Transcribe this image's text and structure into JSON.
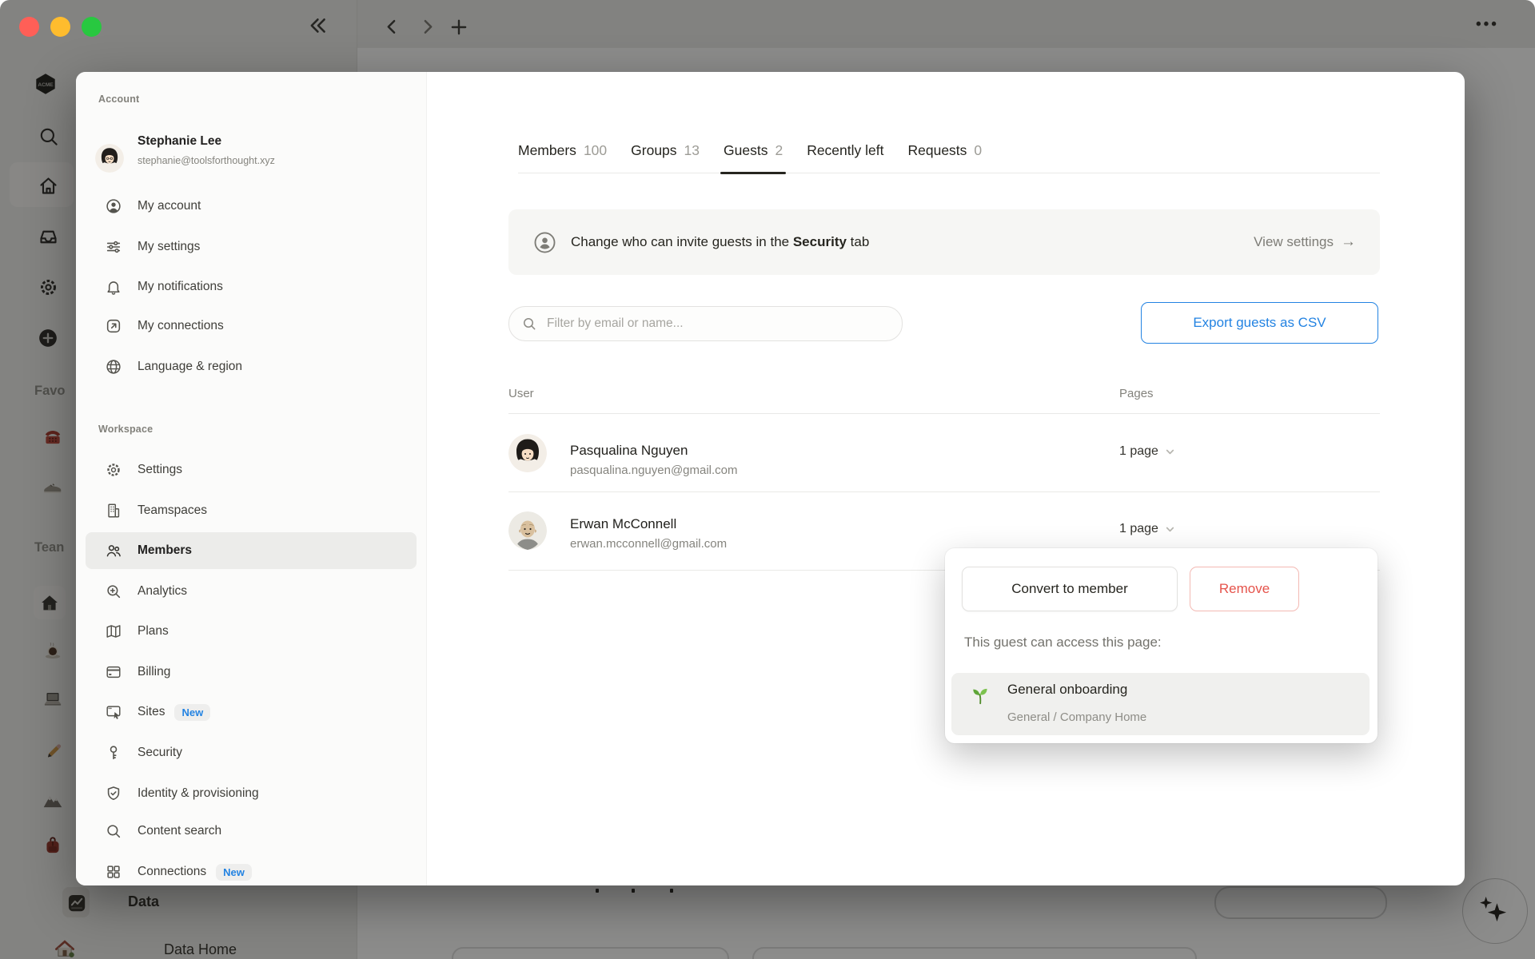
{
  "window": {
    "controls": {
      "close": "close",
      "minimize": "minimize",
      "zoom": "zoom"
    },
    "ellipsis": "•••"
  },
  "rail": {
    "workspace_logo": "ACME",
    "favorites_label": "Favo",
    "teamspaces_label": "Tean",
    "data_section": {
      "label": "Data",
      "icon": "chart-icon"
    },
    "data_home": {
      "label": "Data Home",
      "icon": "house-icon"
    }
  },
  "sidebar": {
    "account_heading": "Account",
    "user": {
      "name": "Stephanie Lee",
      "email": "stephanie@toolsforthought.xyz"
    },
    "account_items": [
      {
        "label": "My account",
        "icon": "person-circle-icon"
      },
      {
        "label": "My settings",
        "icon": "sliders-icon"
      },
      {
        "label": "My notifications",
        "icon": "bell-icon"
      },
      {
        "label": "My connections",
        "icon": "arrow-up-right-box-icon"
      },
      {
        "label": "Language & region",
        "icon": "globe-icon"
      }
    ],
    "workspace_heading": "Workspace",
    "workspace_items": [
      {
        "label": "Settings",
        "icon": "gear-icon"
      },
      {
        "label": "Teamspaces",
        "icon": "building-icon"
      },
      {
        "label": "Members",
        "icon": "people-icon",
        "selected": true
      },
      {
        "label": "Analytics",
        "icon": "magnifier-plus-icon"
      },
      {
        "label": "Plans",
        "icon": "map-icon"
      },
      {
        "label": "Billing",
        "icon": "credit-card-icon"
      },
      {
        "label": "Sites",
        "icon": "browser-cursor-icon",
        "badge": "New"
      },
      {
        "label": "Security",
        "icon": "key-icon"
      },
      {
        "label": "Identity & provisioning",
        "icon": "shield-check-icon"
      },
      {
        "label": "Content search",
        "icon": "magnifier-icon"
      },
      {
        "label": "Connections",
        "icon": "grid-icon",
        "badge": "New"
      }
    ]
  },
  "members_page": {
    "tabs": [
      {
        "label": "Members",
        "count": "100"
      },
      {
        "label": "Groups",
        "count": "13"
      },
      {
        "label": "Guests",
        "count": "2",
        "active": true
      },
      {
        "label": "Recently left",
        "count": ""
      },
      {
        "label": "Requests",
        "count": "0"
      }
    ],
    "banner": {
      "text_before": "Change who can invite guests in the ",
      "text_bold": "Security",
      "text_after": " tab",
      "action_label": "View settings",
      "action_arrow": "→"
    },
    "filter_placeholder": "Filter by email or name...",
    "export_label": "Export guests as CSV",
    "table": {
      "user_column": "User",
      "pages_column": "Pages",
      "rows": [
        {
          "name": "Pasqualina Nguyen",
          "email": "pasqualina.nguyen@gmail.com",
          "pages": "1 page"
        },
        {
          "name": "Erwan McConnell",
          "email": "erwan.mcconnell@gmail.com",
          "pages": "1 page"
        }
      ]
    }
  },
  "guest_popover": {
    "convert_label": "Convert to member",
    "remove_label": "Remove",
    "caption": "This guest can access this page:",
    "page": {
      "title": "General onboarding",
      "path": "General / Company Home",
      "icon": "seedling-icon"
    }
  },
  "colors": {
    "accent_blue": "#2383e2",
    "danger_red": "#e5534b",
    "tab_underline": "#26251f",
    "traffic_red": "#ff5f57",
    "traffic_yellow": "#febc2e",
    "traffic_green": "#28c840"
  }
}
